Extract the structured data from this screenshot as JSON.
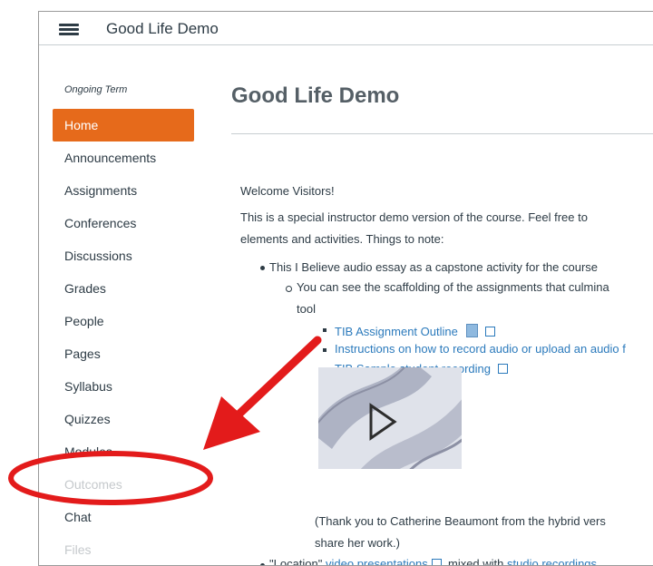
{
  "header": {
    "title": "Good Life Demo"
  },
  "nav": {
    "term": "Ongoing Term",
    "items": [
      {
        "label": "Home"
      },
      {
        "label": "Announcements"
      },
      {
        "label": "Assignments"
      },
      {
        "label": "Conferences"
      },
      {
        "label": "Discussions"
      },
      {
        "label": "Grades"
      },
      {
        "label": "People"
      },
      {
        "label": "Pages"
      },
      {
        "label": "Syllabus"
      },
      {
        "label": "Quizzes"
      },
      {
        "label": "Modules"
      },
      {
        "label": "Outcomes"
      },
      {
        "label": "Chat"
      },
      {
        "label": "Files"
      }
    ]
  },
  "page": {
    "title": "Good Life Demo",
    "welcome": "Welcome Visitors!",
    "intro_line1": "This is a special instructor demo version of the course.  Feel free to",
    "intro_line2": "elements and activities.  Things to note:",
    "bullet1": "This I Believe audio essay as a capstone activity for the course",
    "sub1_line1": "You can see the scaffolding of the assignments that culmina",
    "sub1_line2": "tool",
    "link_outline": "TIB Assignment Outline",
    "link_instructions": "Instructions on how to record audio or upload an audio f",
    "link_sample": "TIB Sample student recording",
    "thanks_line1": "(Thank you to Catherine Beaumont from the hybrid vers",
    "thanks_line2": "share her work.)",
    "bullet2_prefix": "\"Location\"",
    "bullet2_link1": "video presentations",
    "bullet2_mid": ", mixed with",
    "bullet2_link2": "studio recordings"
  },
  "colors": {
    "active_nav": "#e66a1b",
    "link": "#2b7abc",
    "annotation": "#e31b1b"
  }
}
